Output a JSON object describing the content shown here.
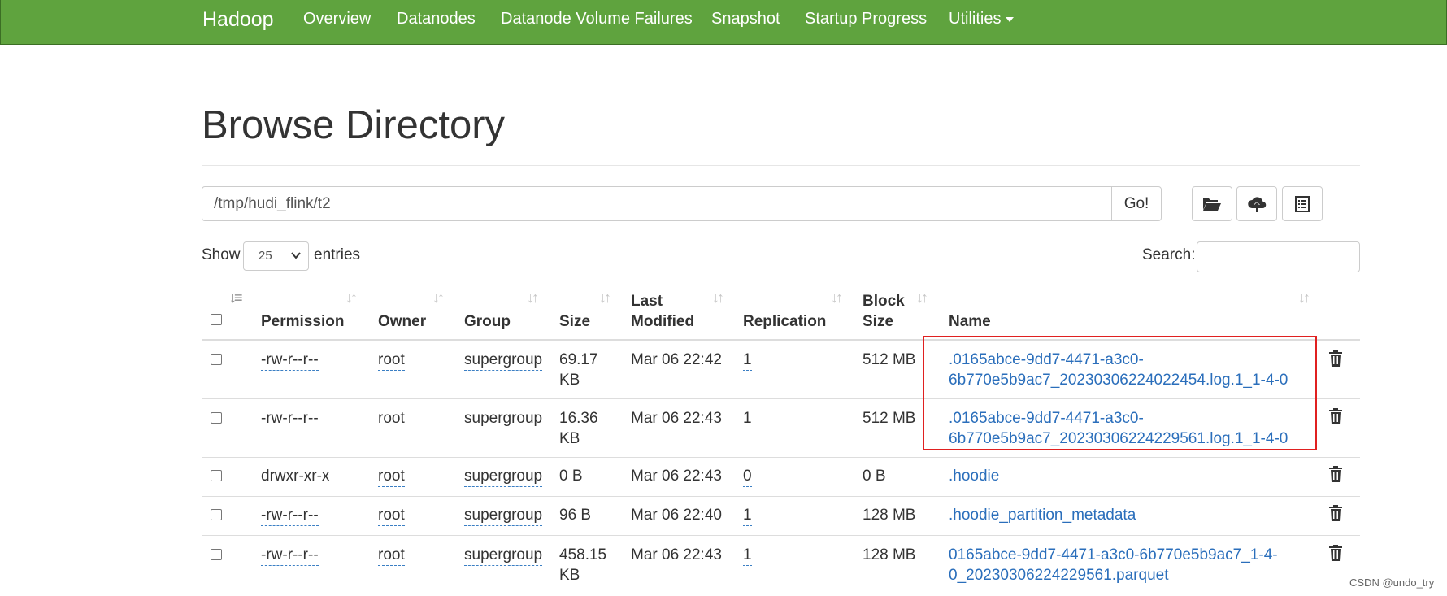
{
  "navbar": {
    "brand": "Hadoop",
    "items": [
      "Overview",
      "Datanodes",
      "Datanode Volume Failures",
      "Snapshot",
      "Startup Progress",
      "Utilities"
    ]
  },
  "page": {
    "title": "Browse Directory"
  },
  "pathbar": {
    "path": "/tmp/hudi_flink/t2",
    "go_label": "Go!"
  },
  "toolbar": {
    "icons": [
      "folder-open-icon",
      "cloud-upload-icon",
      "list-icon"
    ]
  },
  "controls": {
    "show_label": "Show",
    "entries_value": "25",
    "entries_label": "entries",
    "search_label": "Search:"
  },
  "table": {
    "headers": {
      "permission": "Permission",
      "owner": "Owner",
      "group": "Group",
      "size": "Size",
      "last_modified_1": "Last",
      "last_modified_2": "Modified",
      "replication": "Replication",
      "block_size_1": "Block",
      "block_size_2": "Size",
      "name": "Name"
    },
    "rows": [
      {
        "permission": "-rw-r--r--",
        "owner": "root",
        "group": "supergroup",
        "size_1": "69.17",
        "size_2": "KB",
        "modified": "Mar 06 22:42",
        "replication": "1",
        "block_size": "512 MB",
        "name_1": ".0165abce-9dd7-4471-a3c0-",
        "name_2": "6b770e5b9ac7_20230306224022454.log.1_1-4-0"
      },
      {
        "permission": "-rw-r--r--",
        "owner": "root",
        "group": "supergroup",
        "size_1": "16.36",
        "size_2": "KB",
        "modified": "Mar 06 22:43",
        "replication": "1",
        "block_size": "512 MB",
        "name_1": ".0165abce-9dd7-4471-a3c0-",
        "name_2": "6b770e5b9ac7_20230306224229561.log.1_1-4-0"
      },
      {
        "permission": "drwxr-xr-x",
        "owner": "root",
        "group": "supergroup",
        "size_1": "0 B",
        "size_2": "",
        "modified": "Mar 06 22:43",
        "replication": "0",
        "block_size": "0 B",
        "name_1": ".hoodie",
        "name_2": ""
      },
      {
        "permission": "-rw-r--r--",
        "owner": "root",
        "group": "supergroup",
        "size_1": "96 B",
        "size_2": "",
        "modified": "Mar 06 22:40",
        "replication": "1",
        "block_size": "128 MB",
        "name_1": ".hoodie_partition_metadata",
        "name_2": ""
      },
      {
        "permission": "-rw-r--r--",
        "owner": "root",
        "group": "supergroup",
        "size_1": "458.15",
        "size_2": "KB",
        "modified": "Mar 06 22:43",
        "replication": "1",
        "block_size": "128 MB",
        "name_1": "0165abce-9dd7-4471-a3c0-6b770e5b9ac7_1-4-",
        "name_2": "0_20230306224229561.parquet"
      }
    ]
  },
  "watermark": "CSDN @undo_try",
  "colors": {
    "navbar": "#5fa33e",
    "link": "#2a6ebb",
    "highlight": "#e02020"
  }
}
